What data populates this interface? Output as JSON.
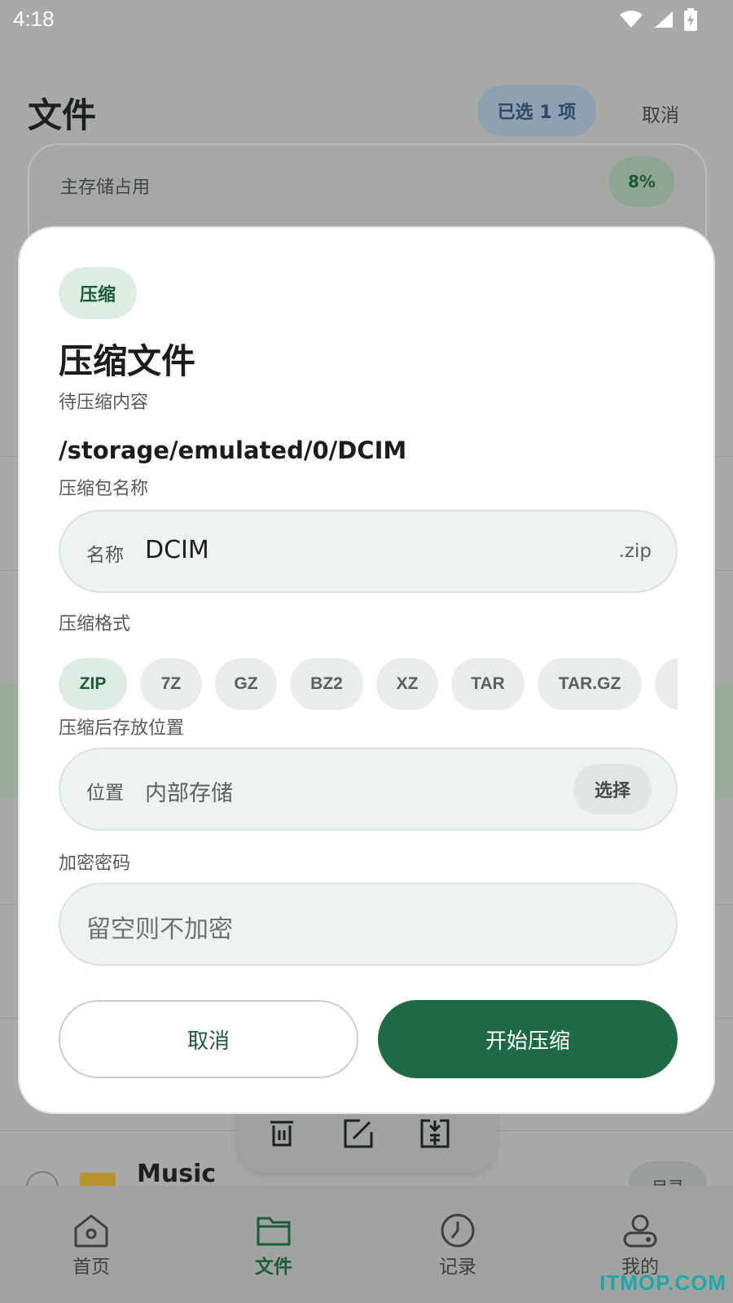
{
  "status_bar": {
    "time": "4:18"
  },
  "page": {
    "title": "文件",
    "selected_label": "已选 1 项",
    "cancel_label": "取消",
    "storage": {
      "label": "主存储占用",
      "percent_label": "8%",
      "percent": 8
    },
    "music_row": {
      "name": "Music",
      "tag": "目录"
    }
  },
  "dialog": {
    "chip": "压缩",
    "title": "压缩文件",
    "source_label": "待压缩内容",
    "source_path": "/storage/emulated/0/DCIM",
    "name_section": "压缩包名称",
    "name_field": {
      "label": "名称",
      "value": "DCIM",
      "suffix": ".zip"
    },
    "format_section": "压缩格式",
    "formats": [
      "ZIP",
      "7Z",
      "GZ",
      "BZ2",
      "XZ",
      "TAR",
      "TAR.GZ"
    ],
    "selected_format": "ZIP",
    "location_section": "压缩后存放位置",
    "location_field": {
      "label": "位置",
      "value": "内部存储",
      "button": "选择"
    },
    "password_section": "加密密码",
    "password_field": {
      "placeholder": "留空则不加密"
    },
    "cancel_button": "取消",
    "start_button": "开始压缩"
  },
  "bottom_nav": {
    "items": [
      {
        "label": "首页",
        "icon": "home-icon"
      },
      {
        "label": "文件",
        "icon": "folder-icon",
        "active": true
      },
      {
        "label": "记录",
        "icon": "clock-icon"
      },
      {
        "label": "我的",
        "icon": "profile-icon"
      }
    ]
  },
  "watermark": "ITMOP.COM",
  "colors": {
    "accent": "#1e6a45",
    "accent_soft": "#dceee2",
    "scrim": "#a7aaa7"
  }
}
